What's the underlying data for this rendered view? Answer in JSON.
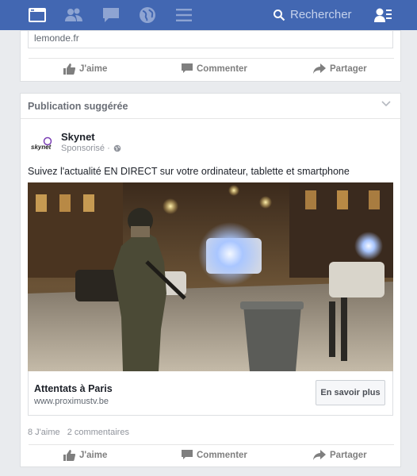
{
  "nav": {
    "search_placeholder": "Rechercher"
  },
  "top_post": {
    "link_domain": "lemonde.fr",
    "actions": {
      "like": "J'aime",
      "comment": "Commenter",
      "share": "Partager"
    }
  },
  "suggested": {
    "header": "Publication suggérée",
    "page_name": "Skynet",
    "avatar_text": "skynet",
    "sponsored": "Sponsorisé · ",
    "post_text": "Suivez l'actualité EN DIRECT sur votre ordinateur, tablette et smartphone",
    "ad_title": "Attentats à Paris",
    "ad_url": "www.proximustv.be",
    "cta": "En savoir plus",
    "likes": "8 J'aime",
    "comments": "2 commentaires",
    "actions": {
      "like": "J'aime",
      "comment": "Commenter",
      "share": "Partager"
    }
  },
  "colors": {
    "nav_bar": "#4267b2",
    "background": "#e9ebee",
    "action_gray": "#7f7f7f"
  },
  "icons": [
    "feed-icon",
    "friends-icon",
    "messages-icon",
    "globe-icon",
    "menu-icon",
    "search-icon",
    "friend-requests-icon"
  ]
}
